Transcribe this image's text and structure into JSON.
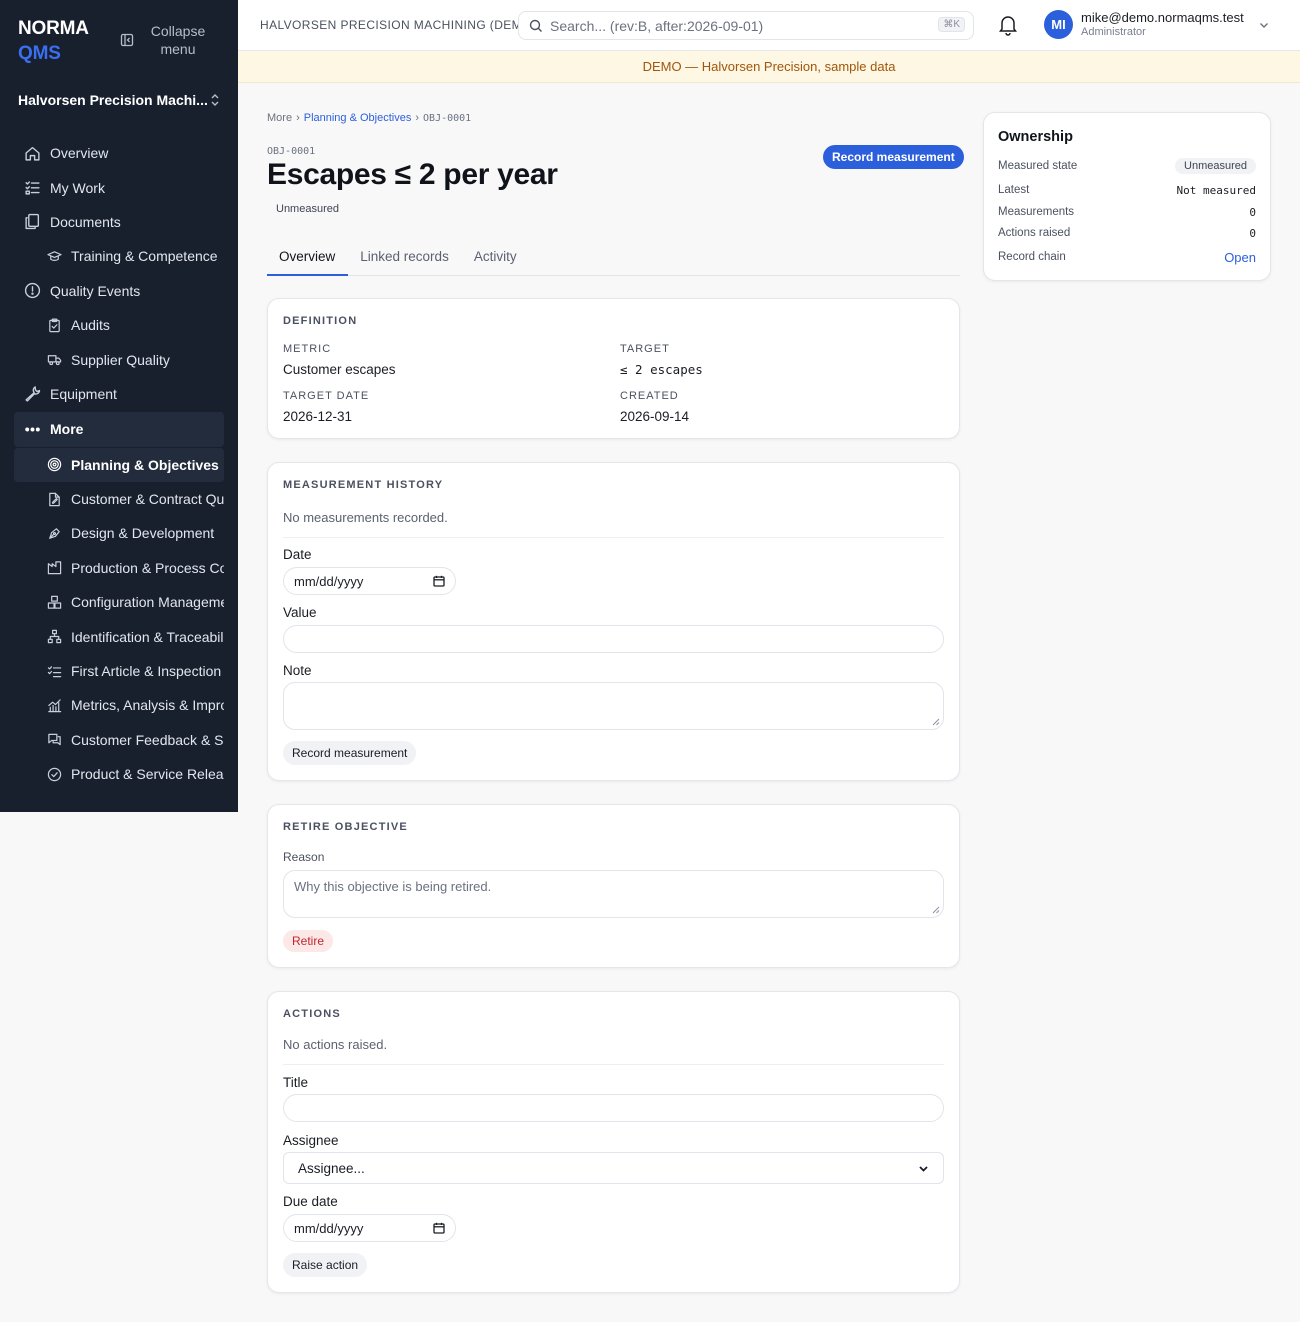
{
  "brand": {
    "line1": "NORMA",
    "line2": "QMS"
  },
  "sidebar": {
    "collapse_label": "Collapse menu",
    "org_name": "Halvorsen Precision Machi...",
    "items": [
      {
        "label": "Overview",
        "icon": "home-icon"
      },
      {
        "label": "My Work",
        "icon": "checklist-icon"
      },
      {
        "label": "Documents",
        "icon": "documents-icon"
      },
      {
        "label": "Training & Competence",
        "icon": "graduation-cap-icon",
        "sub": true
      },
      {
        "label": "Quality Events",
        "icon": "alert-circle-icon"
      },
      {
        "label": "Audits",
        "icon": "clipboard-check-icon",
        "sub": true
      },
      {
        "label": "Supplier Quality",
        "icon": "truck-icon",
        "sub": true
      },
      {
        "label": "Equipment",
        "icon": "wrench-icon"
      },
      {
        "label": "More",
        "icon": "more-dots-icon"
      },
      {
        "label": "Planning & Objectives",
        "icon": "target-icon",
        "sub": true,
        "active": true
      },
      {
        "label": "Customer & Contract Qua",
        "icon": "file-edit-icon",
        "sub": true
      },
      {
        "label": "Design & Development",
        "icon": "pen-tool-icon",
        "sub": true
      },
      {
        "label": "Production & Process Cor",
        "icon": "factory-icon",
        "sub": true
      },
      {
        "label": "Configuration Manageme",
        "icon": "boxes-icon",
        "sub": true
      },
      {
        "label": "Identification & Traceabili",
        "icon": "network-icon",
        "sub": true
      },
      {
        "label": "First Article & Inspection I",
        "icon": "list-checks-icon",
        "sub": true
      },
      {
        "label": "Metrics, Analysis & Impro",
        "icon": "bar-chart-icon",
        "sub": true
      },
      {
        "label": "Customer Feedback & Sat",
        "icon": "message-icon",
        "sub": true
      },
      {
        "label": "Product & Service Releas",
        "icon": "check-circle-icon",
        "sub": true
      }
    ]
  },
  "topbar": {
    "company": "HALVORSEN PRECISION MACHINING (DEMO)",
    "search_placeholder": "Search... (rev:B, after:2026-09-01)",
    "search_kbd": "⌘K",
    "user_email": "mike@demo.normaqms.test",
    "user_role": "Administrator",
    "user_initials": "MI"
  },
  "banner": "DEMO — Halvorsen Precision, sample data",
  "breadcrumb": {
    "root": "More",
    "section": "Planning & Objectives",
    "current": "OBJ-0001"
  },
  "record": {
    "id": "OBJ-0001",
    "title": "Escapes ≤ 2 per year",
    "state": "Unmeasured",
    "primary_action": "Record measurement"
  },
  "tabs": [
    "Overview",
    "Linked records",
    "Activity"
  ],
  "definition": {
    "title": "Definition",
    "metric_label": "Metric",
    "metric_value": "Customer escapes",
    "target_label": "Target",
    "target_value": "≤ 2 escapes",
    "target_date_label": "Target date",
    "target_date_value": "2026-12-31",
    "created_label": "Created",
    "created_value": "2026-09-14"
  },
  "measurement": {
    "title": "Measurement history",
    "empty": "No measurements recorded.",
    "date_label": "Date",
    "date_placeholder": "mm/dd/yyyy",
    "value_label": "Value",
    "note_label": "Note",
    "submit": "Record measurement"
  },
  "retire": {
    "title": "Retire objective",
    "reason_label": "Reason",
    "reason_placeholder": "Why this objective is being retired.",
    "submit": "Retire"
  },
  "actions": {
    "title": "Actions",
    "empty": "No actions raised.",
    "title_label": "Title",
    "assignee_label": "Assignee",
    "assignee_selected": "Assignee...",
    "due_label": "Due date",
    "due_placeholder": "mm/dd/yyyy",
    "submit": "Raise action"
  },
  "ownership": {
    "title": "Ownership",
    "measured_state_label": "Measured state",
    "measured_state_value": "Unmeasured",
    "latest_label": "Latest",
    "latest_value": "Not measured",
    "measurements_label": "Measurements",
    "measurements_value": "0",
    "actions_label": "Actions raised",
    "actions_value": "0",
    "chain_label": "Record chain",
    "chain_value": "Open"
  },
  "colors": {
    "sidebar_bg": "#18202e",
    "accent": "#2c5fdc",
    "banner_bg": "#fdf7e3",
    "banner_text": "#a1560c",
    "danger": "#c0262d"
  }
}
